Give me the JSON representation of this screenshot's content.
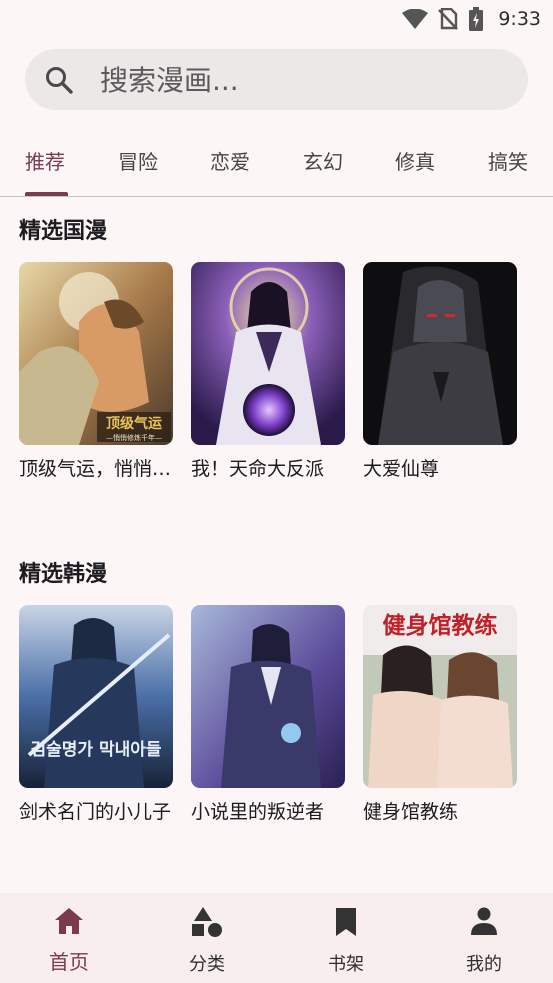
{
  "status_bar": {
    "time": "9:33"
  },
  "search": {
    "placeholder": "搜索漫画..."
  },
  "tabs": [
    {
      "label": "推荐",
      "active": true
    },
    {
      "label": "冒险"
    },
    {
      "label": "恋爱"
    },
    {
      "label": "玄幻"
    },
    {
      "label": "修真"
    },
    {
      "label": "搞笑"
    }
  ],
  "sections": [
    {
      "title": "精选国漫",
      "comics": [
        {
          "title": "顶级气运，悄悄修炼千年",
          "cover_text": "顶级气运",
          "cover_subtext": "—悄悄修炼千年—"
        },
        {
          "title": "我！天命大反派"
        },
        {
          "title": "大爱仙尊"
        }
      ]
    },
    {
      "title": "精选韩漫",
      "comics": [
        {
          "title": "剑术名门的小儿子",
          "cover_text": "검술명가 막내아들"
        },
        {
          "title": "小说里的叛逆者"
        },
        {
          "title": "健身馆教练",
          "cover_text": "健身馆教练"
        }
      ]
    }
  ],
  "bottom_nav": [
    {
      "label": "首页",
      "icon": "home-icon",
      "active": true
    },
    {
      "label": "分类",
      "icon": "category-icon"
    },
    {
      "label": "书架",
      "icon": "bookmark-icon"
    },
    {
      "label": "我的",
      "icon": "person-icon"
    }
  ],
  "colors": {
    "accent": "#7a3b4c",
    "background": "#fdf6f6",
    "search_bg": "#ede8e8",
    "nav_bg": "#f8eeee"
  }
}
